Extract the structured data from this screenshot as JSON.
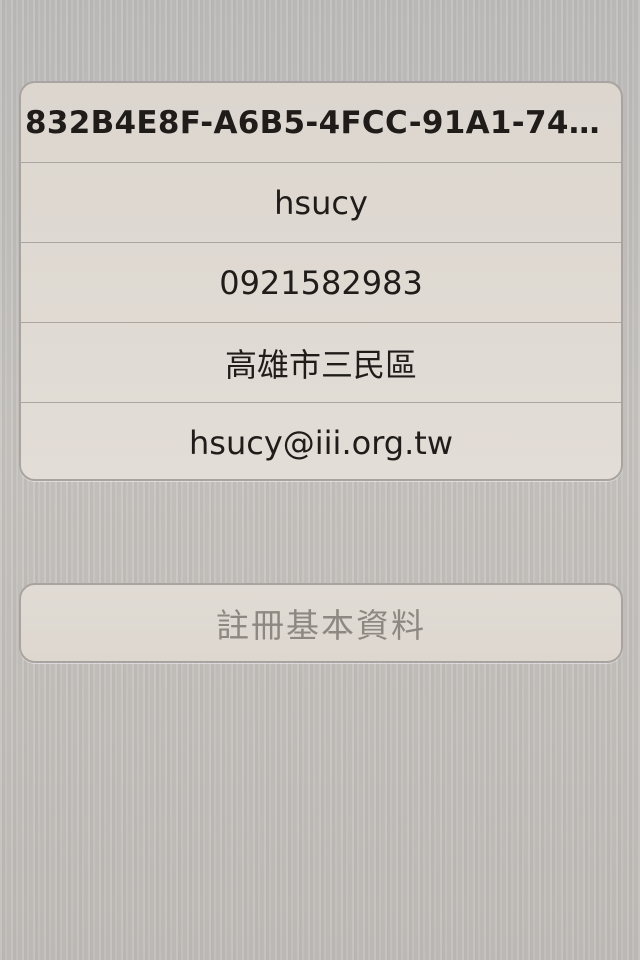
{
  "profile": {
    "device_id": "832B4E8F-A6B5-4FCC-91A1-74E…",
    "username": "hsucy",
    "phone": "0921582983",
    "address": "高雄市三民區",
    "email": "hsucy@iii.org.tw"
  },
  "actions": {
    "register_label": "註冊基本資料"
  }
}
